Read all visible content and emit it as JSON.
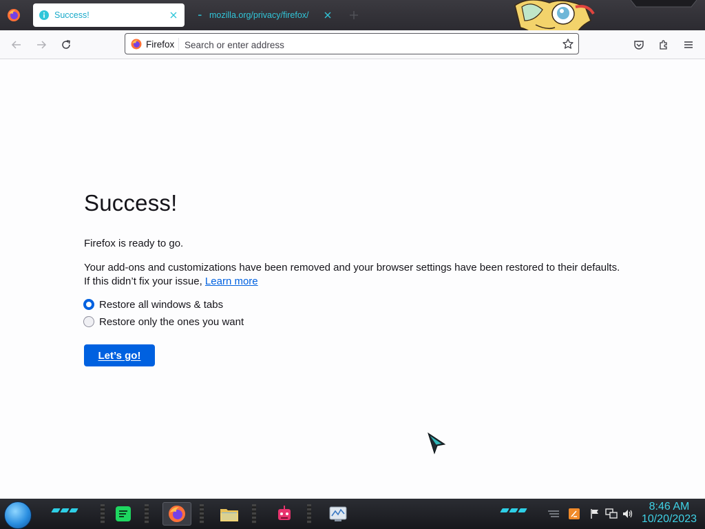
{
  "browser": {
    "tabs": [
      {
        "title": "Success!",
        "active": true
      },
      {
        "title": "mozilla.org/privacy/firefox/",
        "active": false
      }
    ],
    "identity_label": "Firefox",
    "address_placeholder": "Search or enter address"
  },
  "page": {
    "title": "Success!",
    "ready_text": "Firefox is ready to go.",
    "description": "Your add-ons and customizations have been removed and your browser settings have been restored to their defaults.",
    "help_prefix": "If this didn’t fix your issue,",
    "learn_more": "Learn more",
    "options": [
      {
        "label": "Restore all windows & tabs",
        "selected": true
      },
      {
        "label": "Restore only the ones you want",
        "selected": false
      }
    ],
    "button_label": "Let’s go!"
  },
  "taskbar": {
    "time": "8:46 AM",
    "date": "10/20/2023",
    "apps": [
      "notes-app",
      "firefox",
      "file-explorer",
      "robot-app",
      "system-monitor"
    ]
  },
  "colors": {
    "accent": "#0061e0",
    "tab_text": "#17a9c9",
    "clock": "#3fd2e6"
  }
}
